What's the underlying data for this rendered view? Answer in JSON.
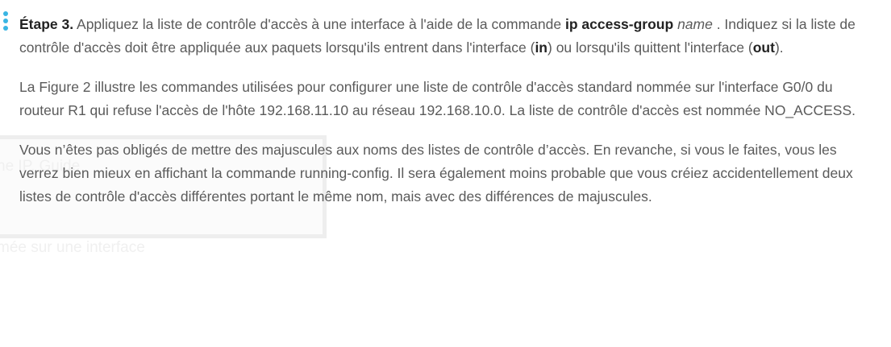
{
  "accent_dot_colors": [
    "#39b5e3",
    "#39b5e3",
    "#39b5e3"
  ],
  "ghost": {
    "line1": "ne IP. Guide",
    "line2": "mée sur une interface"
  },
  "paragraph1": {
    "label": "Étape 3.",
    "t1": " Appliquez la liste de contrôle d'accès à une interface à l'aide de la commande ",
    "cmd": "ip access-group",
    "t2": " ",
    "arg": "name",
    "t3": " . Indiquez si la liste de contrôle d'accès doit être appliquée aux paquets lorsqu'ils entrent dans l'interface (",
    "in": "in",
    "t4": ") ou lorsqu'ils quittent l'interface (",
    "out": "out",
    "t5": ")."
  },
  "paragraph2": "La Figure 2 illustre les commandes utilisées pour configurer une liste de contrôle d'accès standard nommée sur l'interface G0/0 du routeur R1 qui refuse l'accès de l'hôte 192.168.11.10 au réseau 192.168.10.0. La liste de contrôle d'accès est nommée NO_ACCESS.",
  "paragraph3": "Vous n’êtes pas obligés de mettre des majuscules aux noms des listes de contrôle d’accès. En revanche, si vous le faites, vous les verrez bien mieux en affichant la commande running-config. Il sera également moins probable que vous créiez accidentellement deux listes de contrôle d'accès différentes portant le même nom, mais avec des différences de majuscules."
}
